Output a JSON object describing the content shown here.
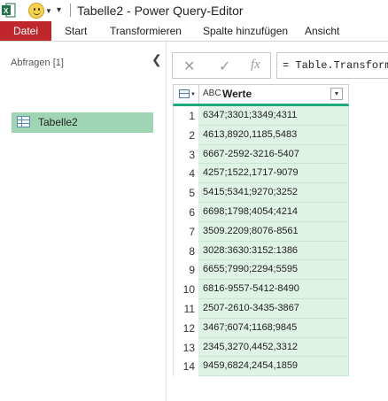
{
  "window": {
    "title": "Tabelle2 - Power Query-Editor"
  },
  "quick_access": {
    "icons": [
      "excel-icon",
      "smiley-icon",
      "chevron-down-icon",
      "customize-toolbar-icon"
    ]
  },
  "ribbon": {
    "tabs": [
      "Datei",
      "Start",
      "Transformieren",
      "Spalte hinzufügen",
      "Ansicht"
    ],
    "file_color": "#c0272d"
  },
  "queries": {
    "header": "Abfragen [1]",
    "items": [
      {
        "label": "Tabelle2"
      }
    ],
    "selected_color": "#9fd5b2"
  },
  "formula_bar": {
    "cancel": "✕",
    "commit": "✓",
    "fx": "fx",
    "text": "= Table.TransformColumnTypes"
  },
  "grid": {
    "column": {
      "type_icon": "ABC",
      "name": "Werte"
    },
    "header_accent": "#1fab79",
    "rows": [
      {
        "n": "1",
        "value": "6347;3301;3349;4311"
      },
      {
        "n": "2",
        "value": "4613,8920,1185,5483"
      },
      {
        "n": "3",
        "value": "6667-2592-3216-5407"
      },
      {
        "n": "4",
        "value": "4257;1522,1717-9079"
      },
      {
        "n": "5",
        "value": "5415;5341;9270;3252"
      },
      {
        "n": "6",
        "value": "6698;1798;4054;4214"
      },
      {
        "n": "7",
        "value": "3509.2209;8076-8561"
      },
      {
        "n": "8",
        "value": "3028:3630:3152:1386"
      },
      {
        "n": "9",
        "value": "6655;7990;2294;5595"
      },
      {
        "n": "10",
        "value": "6816-9557-5412-8490"
      },
      {
        "n": "11",
        "value": "2507-2610-3435-3867"
      },
      {
        "n": "12",
        "value": "3467;6074;1168;9845"
      },
      {
        "n": "13",
        "value": "2345,3270,4452,3312"
      },
      {
        "n": "14",
        "value": "9459,6824,2454,1859"
      }
    ]
  }
}
